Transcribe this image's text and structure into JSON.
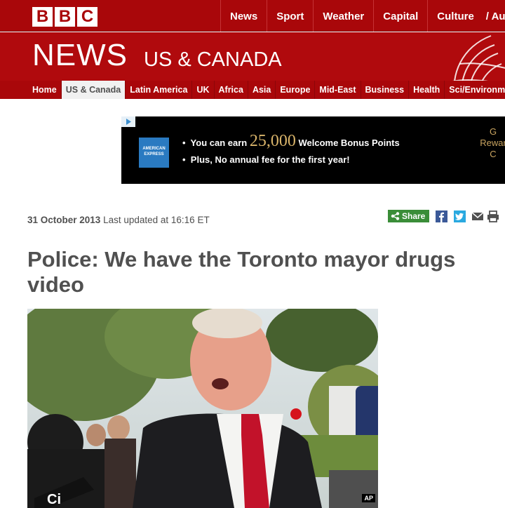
{
  "header": {
    "logo_letters": [
      "B",
      "B",
      "C"
    ],
    "top_nav": [
      "News",
      "Sport",
      "Weather",
      "Capital",
      "Culture",
      "/ Autos"
    ],
    "colors": {
      "brand_red": "#a9070a",
      "share_green": "#3a8d38"
    }
  },
  "masthead": {
    "title": "NEWS",
    "region": "US & CANADA"
  },
  "section_nav": {
    "items": [
      "Home",
      "US & Canada",
      "Latin America",
      "UK",
      "Africa",
      "Asia",
      "Europe",
      "Mid-East",
      "Business",
      "Health",
      "Sci/Environment"
    ],
    "active": "US & Canada"
  },
  "ad": {
    "brand": "AMERICAN EXPRESS",
    "line1_pre": "You can earn",
    "line1_big": "25,000",
    "line1_post": "Welcome Bonus Points",
    "line2": "Plus, No annual fee for the first year!",
    "right_text": [
      "G",
      "Rewar",
      "C"
    ],
    "icon": "ad-choices-icon"
  },
  "article": {
    "date": "31 October 2013",
    "updated": "Last updated at 16:16 ET",
    "share_label": "Share",
    "social_icons": [
      "facebook-icon",
      "twitter-icon",
      "email-icon",
      "print-icon"
    ],
    "headline": "Police: We have the Toronto mayor drugs video",
    "photo_credit": "AP"
  }
}
